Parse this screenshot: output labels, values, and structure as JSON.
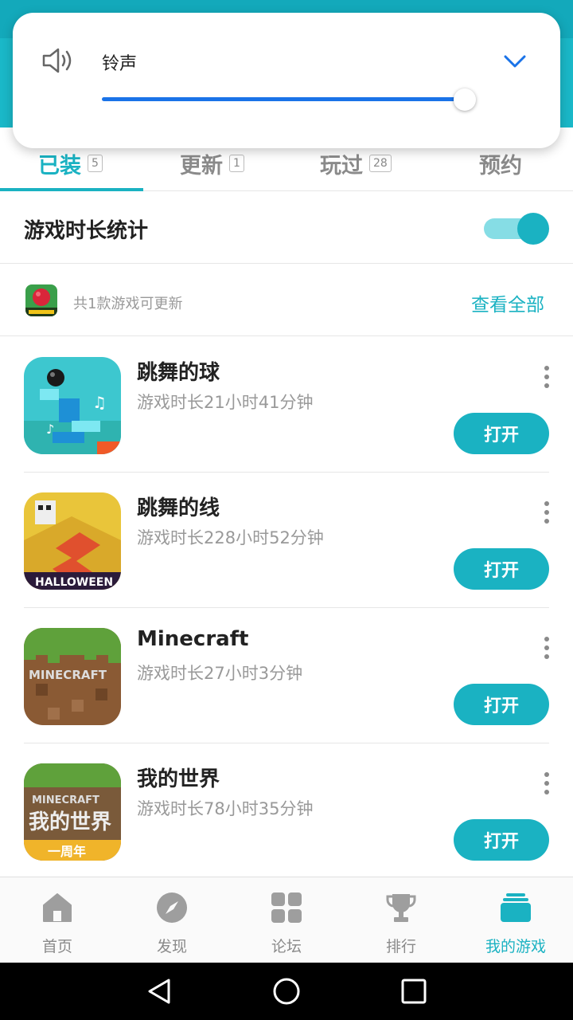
{
  "volume_popup": {
    "label": "铃声",
    "level_fraction": 0.95,
    "accent_color": "#1a73e8"
  },
  "tabs": [
    {
      "label": "已装",
      "badge": "5",
      "active": true
    },
    {
      "label": "更新",
      "badge": "1",
      "active": false
    },
    {
      "label": "玩过",
      "badge": "28",
      "active": false
    },
    {
      "label": "预约",
      "badge": "",
      "active": false
    }
  ],
  "stats": {
    "title": "游戏时长统计",
    "toggle_on": true
  },
  "update_notice": {
    "text": "共1款游戏可更新",
    "view_all": "查看全部"
  },
  "games": [
    {
      "name": "跳舞的球",
      "playtime": "游戏时长21小时41分钟",
      "action": "打开"
    },
    {
      "name": "跳舞的线",
      "playtime": "游戏时长228小时52分钟",
      "action": "打开"
    },
    {
      "name": "Minecraft",
      "playtime": "游戏时长27小时3分钟",
      "action": "打开"
    },
    {
      "name": "我的世界",
      "playtime": "游戏时长78小时35分钟",
      "action": "打开"
    }
  ],
  "bottom_nav": [
    {
      "label": "首页",
      "icon": "home-icon",
      "active": false
    },
    {
      "label": "发现",
      "icon": "compass-icon",
      "active": false
    },
    {
      "label": "论坛",
      "icon": "grid-icon",
      "active": false
    },
    {
      "label": "排行",
      "icon": "trophy-icon",
      "active": false
    },
    {
      "label": "我的游戏",
      "icon": "stack-icon",
      "active": true
    }
  ],
  "colors": {
    "accent": "#1ab2c2",
    "header": "#1ab8c8"
  }
}
